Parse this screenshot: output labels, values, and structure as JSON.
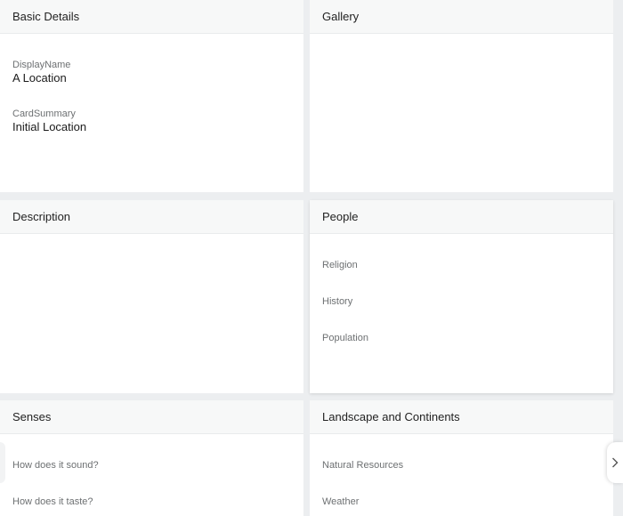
{
  "cards": {
    "basic": {
      "title": "Basic Details",
      "display_name_label": "DisplayName",
      "display_name_value": "A Location",
      "card_summary_label": "CardSummary",
      "card_summary_value": "Initial Location"
    },
    "gallery": {
      "title": "Gallery"
    },
    "description": {
      "title": "Description"
    },
    "people": {
      "title": "People",
      "fields": [
        "Religion",
        "History",
        "Population"
      ]
    },
    "senses": {
      "title": "Senses",
      "fields": [
        "How does it sound?",
        "How does it taste?"
      ]
    },
    "landscape": {
      "title": "Landscape and Continents",
      "fields": [
        "Natural Resources",
        "Weather"
      ]
    }
  },
  "nav": {
    "next_icon": "chevron-right-icon"
  }
}
